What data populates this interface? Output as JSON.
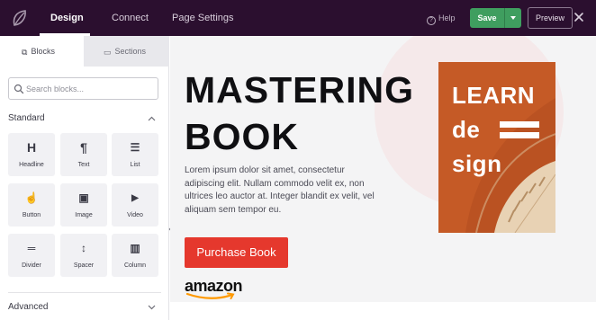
{
  "topbar": {
    "tabs": [
      {
        "label": "Design",
        "active": true
      },
      {
        "label": "Connect",
        "active": false
      },
      {
        "label": "Page Settings",
        "active": false
      }
    ],
    "help_label": "Help",
    "help_icon": "?",
    "save_label": "Save",
    "preview_label": "Preview"
  },
  "sidebar": {
    "tabs": [
      {
        "label": "Blocks",
        "glyph": "⧉"
      },
      {
        "label": "Sections",
        "glyph": "▭"
      }
    ],
    "search": {
      "placeholder": "Search blocks..."
    },
    "groups": {
      "standard": "Standard",
      "advanced": "Advanced"
    },
    "blocks": [
      {
        "label": "Headline",
        "icon": "H"
      },
      {
        "label": "Text",
        "icon": "¶"
      },
      {
        "label": "List",
        "icon": "☰"
      },
      {
        "label": "Button",
        "icon": "☝"
      },
      {
        "label": "Image",
        "icon": "▣"
      },
      {
        "label": "Video",
        "icon": "▶"
      },
      {
        "label": "Divider",
        "icon": "═"
      },
      {
        "label": "Spacer",
        "icon": "↕"
      },
      {
        "label": "Column",
        "icon": "▥"
      }
    ]
  },
  "canvas": {
    "title_line1": "MASTERING",
    "title_line2": "BOOK",
    "description": "Lorem ipsum dolor sit amet, consectetur adipiscing elit. Nullam commodo velit ex, non ultrices leo auctor at. Integer blandit ex velit, vel aliquam sem tempor eu.",
    "cta_label": "Purchase Book",
    "amazon_logo_text": "amazon",
    "book_cover": {
      "line1": "LEARN",
      "line2": "de",
      "line3": "sign"
    }
  },
  "colors": {
    "topbar_bg": "#2b0f2f",
    "save_green": "#3f9e5f",
    "cta_red": "#e5382d",
    "book_orange": "#c55a26"
  }
}
